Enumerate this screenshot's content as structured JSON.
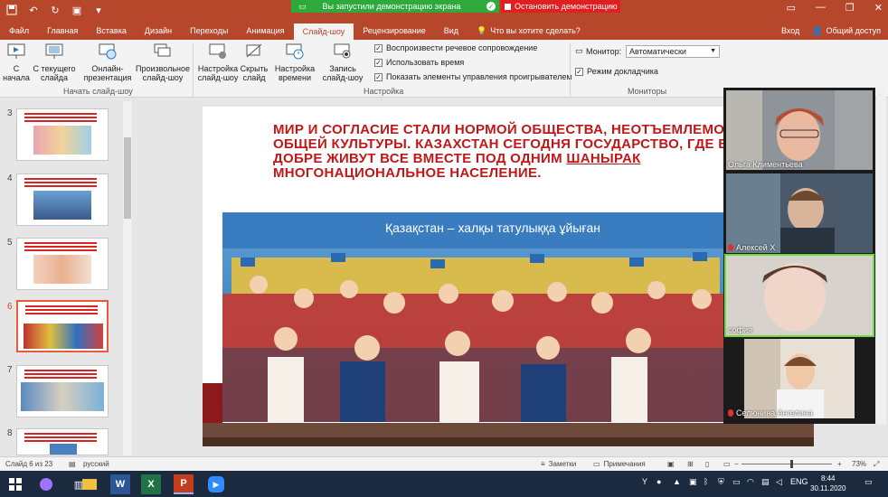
{
  "titlebar": {
    "share_message": "Вы запустили демонстрацию экрана",
    "stop_label": "Остановить демонстрацию",
    "colors": {
      "brand": "#b7472a",
      "share": "#2eaa3c",
      "stop": "#e02020"
    }
  },
  "tabs": [
    {
      "label": "Файл"
    },
    {
      "label": "Главная"
    },
    {
      "label": "Вставка"
    },
    {
      "label": "Дизайн"
    },
    {
      "label": "Переходы"
    },
    {
      "label": "Анимация"
    },
    {
      "label": "Слайд-шоу"
    },
    {
      "label": "Рецензирование"
    },
    {
      "label": "Вид"
    }
  ],
  "help_search": "Что вы хотите сделать?",
  "account": {
    "signin": "Вход",
    "share": "Общий доступ"
  },
  "ribbon": {
    "from_start": "С начала",
    "from_current": "С текущего слайда",
    "online": "Онлайн-презентация",
    "custom": "Произвольное слайд-шоу",
    "group_start": "Начать слайд-шоу",
    "setup": "Настройка слайд-шоу",
    "hide": "Скрыть слайд",
    "timing": "Настройка времени",
    "record": "Запись слайд-шоу",
    "opt_narration": "Воспроизвести речевое сопровождение",
    "opt_timings": "Использовать время",
    "opt_controls": "Показать элементы управления проигрывателем",
    "group_setup": "Настройка",
    "monitor_label": "Монитор:",
    "monitor_value": "Автоматически",
    "presenter_view": "Режим докладчика",
    "group_monitors": "Мониторы"
  },
  "thumbnails": [
    {
      "num": "3",
      "selected": false
    },
    {
      "num": "4",
      "selected": false
    },
    {
      "num": "5",
      "selected": false
    },
    {
      "num": "6",
      "selected": true
    },
    {
      "num": "7",
      "selected": false
    },
    {
      "num": "8",
      "selected": false
    }
  ],
  "slide": {
    "title_before": "МИР И СОГЛАСИЕ СТАЛИ НОРМОЙ ОБЩЕСТВА, НЕОТЪЕМЛЕМОЙ ЧАСТЬЮ ОБЩЕЙ КУЛЬТУРЫ. КАЗАХСТАН СЕГОДНЯ ГОСУДАРСТВО, ГДЕ В МИРЕ И ДОБРЕ ЖИВУТ ВСЕ ВМЕСТЕ ПОД ОДНИМ ",
    "title_underlined": "ШАНЫРАК",
    "title_after": " МНОГОНАЦИОНАЛЬНОЕ НАСЕЛЕНИЕ.",
    "banner_text": "Қазақстан – халқы татулыққа ұйыған",
    "title_color": "#c01818"
  },
  "participants": [
    {
      "name": "Ольга Климентьева",
      "muted": false
    },
    {
      "name": "Алексей Х",
      "muted": true
    },
    {
      "name": "софия",
      "muted": false
    },
    {
      "name": "Селюнина Ангелина",
      "muted": true
    }
  ],
  "status": {
    "slide_info": "Слайд 6 из 23",
    "language": "русский",
    "notes": "Заметки",
    "comments": "Примечания",
    "zoom": "73%"
  },
  "taskbar": {
    "lang": "ENG",
    "time": "8:44",
    "date": "30.11.2020"
  }
}
